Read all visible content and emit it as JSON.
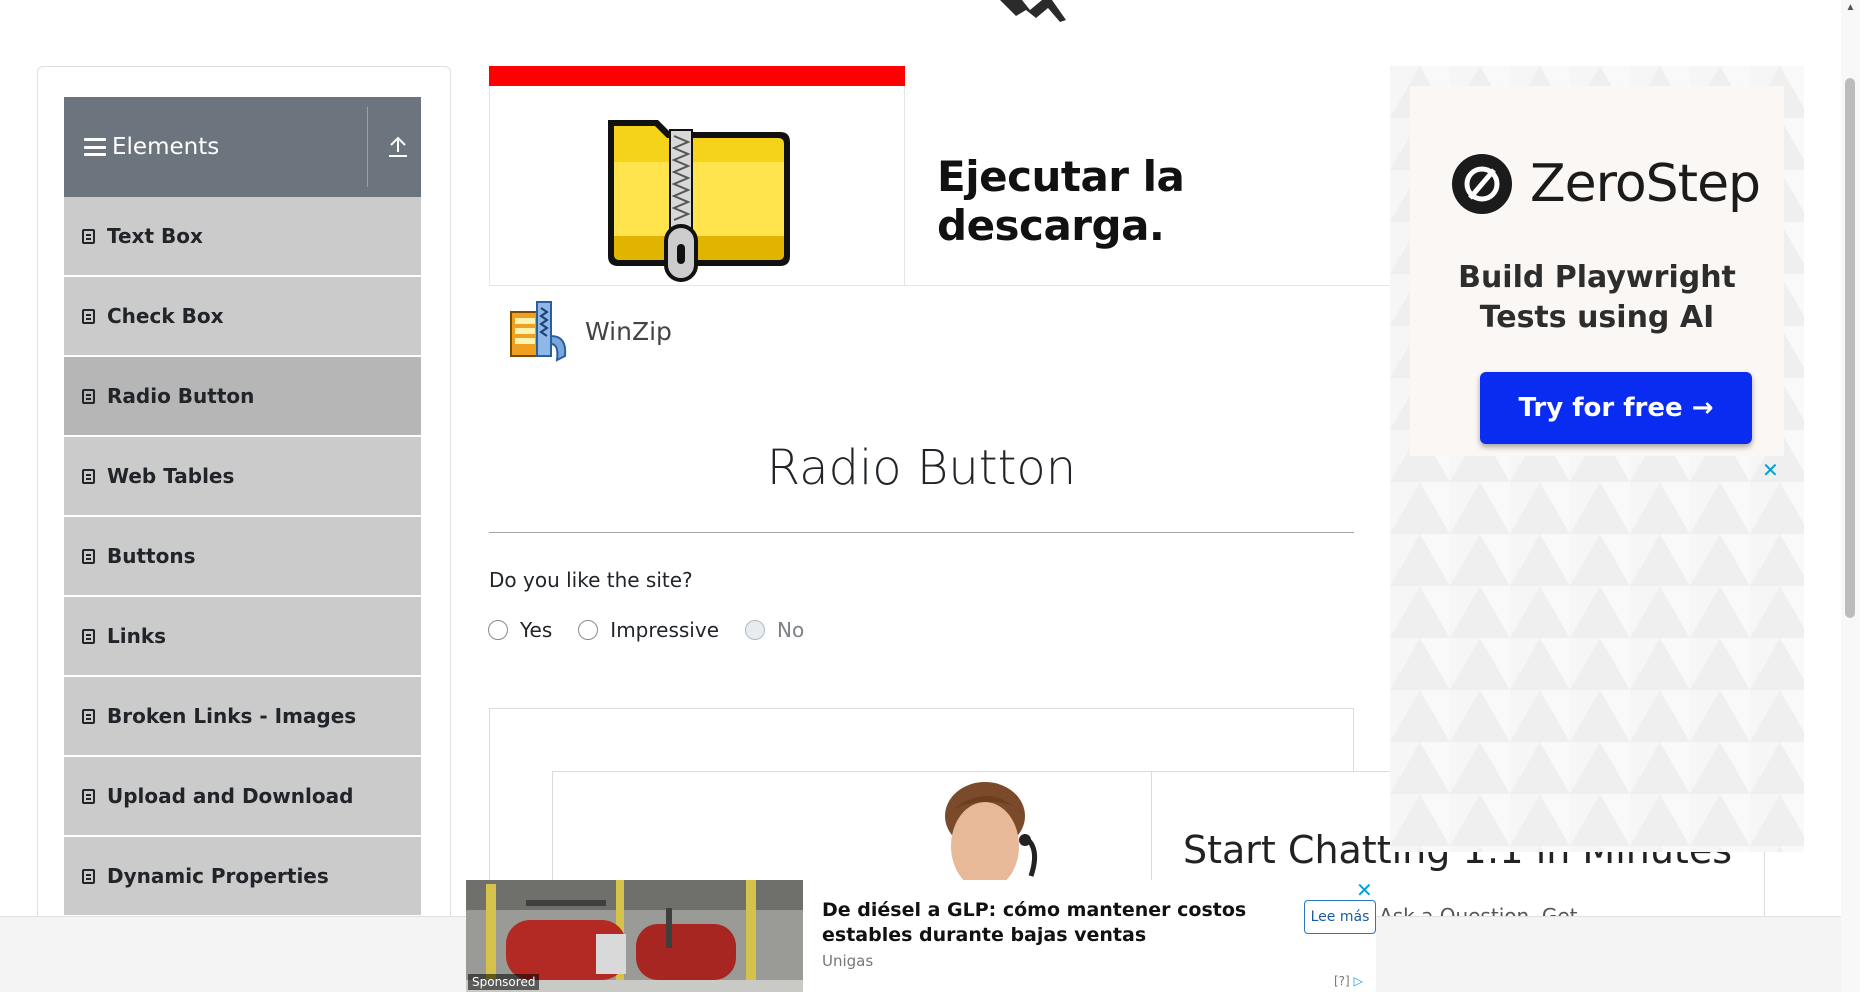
{
  "sidebar": {
    "group_title": "Elements",
    "items": [
      {
        "label": "Text Box",
        "active": false
      },
      {
        "label": "Check Box",
        "active": false
      },
      {
        "label": "Radio Button",
        "active": true
      },
      {
        "label": "Web Tables",
        "active": false
      },
      {
        "label": "Buttons",
        "active": false
      },
      {
        "label": "Links",
        "active": false
      },
      {
        "label": "Broken Links - Images",
        "active": false
      },
      {
        "label": "Upload and Download",
        "active": false
      },
      {
        "label": "Dynamic Properties",
        "active": false
      }
    ]
  },
  "ad_top": {
    "headline": "Ejecutar la descarga.",
    "brand": "WinZip"
  },
  "main": {
    "title": "Radio Button",
    "question": "Do you like the site?",
    "options": [
      {
        "label": "Yes",
        "checked": false,
        "disabled": false
      },
      {
        "label": "Impressive",
        "checked": false,
        "disabled": false
      },
      {
        "label": "No",
        "checked": false,
        "disabled": true
      }
    ]
  },
  "ad_inner": {
    "title": "Start Chatting 1:1 in Minutes",
    "subtitle": "Answer in Minutes. Ask a Question. Get"
  },
  "right_ad": {
    "brand": "ZeroStep",
    "tagline_line1": "Build Playwright",
    "tagline_line2": "Tests using AI",
    "button": "Try for free →",
    "close": "✕"
  },
  "sticky_ad": {
    "sponsored": "Sponsored",
    "title": "De diésel a GLP: cómo mantener costos estables durante bajas ventas",
    "brand": "Unigas",
    "more": "Lee más",
    "close": "✕",
    "info": "[?]"
  },
  "colors": {
    "sidebar_header": "#6c757d",
    "sidebar_item": "#cbcbcb",
    "sidebar_active": "#b6b6b6",
    "zerostep_button": "#0a2bf0",
    "ad_red_bar": "#ff0000"
  }
}
